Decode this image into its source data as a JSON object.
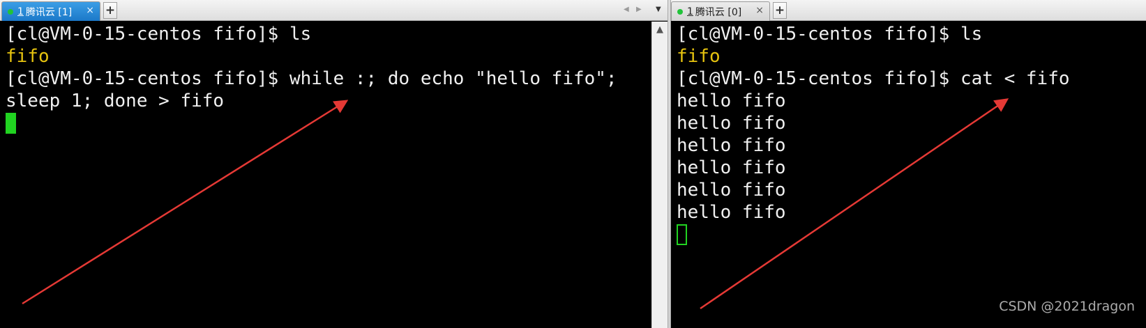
{
  "left_pane": {
    "tab": {
      "number": "1",
      "label": "腾讯云 [1]",
      "close": "×"
    },
    "new_tab": "+",
    "nav": {
      "prev": "◀",
      "next": "▶",
      "menu": "▼"
    },
    "lines": [
      "[cl@VM-0-15-centos fifo]$ ls",
      "fifo",
      "[cl@VM-0-15-centos fifo]$ while :; do echo \"hello fifo\";",
      "sleep 1; done > fifo"
    ],
    "scroll_up": "▲"
  },
  "right_pane": {
    "tab": {
      "number": "1",
      "label": "腾讯云 [0]",
      "close": "×"
    },
    "new_tab": "+",
    "lines": [
      "[cl@VM-0-15-centos fifo]$ ls",
      "fifo",
      "[cl@VM-0-15-centos fifo]$ cat < fifo",
      "hello fifo",
      "hello fifo",
      "hello fifo",
      "hello fifo",
      "hello fifo",
      "hello fifo"
    ]
  },
  "colors": {
    "terminal_bg": "#000000",
    "terminal_fg": "#f0f0f0",
    "directory_yellow": "#e6c30f",
    "cursor_green": "#21d321",
    "annotation_red": "#e53935",
    "active_tab_blue": "#1b78c8"
  },
  "watermark": "CSDN @2021dragon"
}
